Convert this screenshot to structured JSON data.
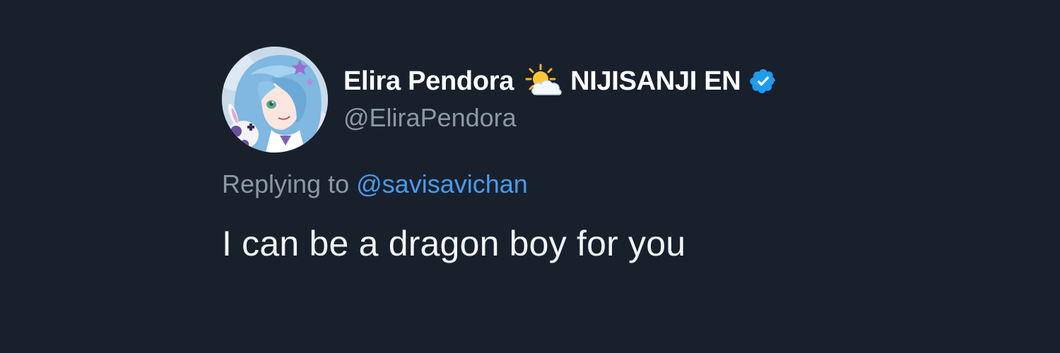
{
  "tweet": {
    "author": {
      "name_part_1": "Elira Pendora",
      "name_emoji": "sun-behind-cloud-icon",
      "name_part_2": "NIJISANJI EN",
      "verified": true,
      "handle": "@EliraPendora",
      "avatar": "profile-avatar-anime-character"
    },
    "reply": {
      "prefix": "Replying to",
      "mention": "@savisavichan"
    },
    "text": "I can be a dragon boy for you"
  },
  "colors": {
    "background": "#18202c",
    "name": "#ffffff",
    "secondary_text": "#8b98a5",
    "mention": "#4a9bea",
    "verified_badge": "#1d9bf0",
    "body_text": "#f2f4f6"
  }
}
